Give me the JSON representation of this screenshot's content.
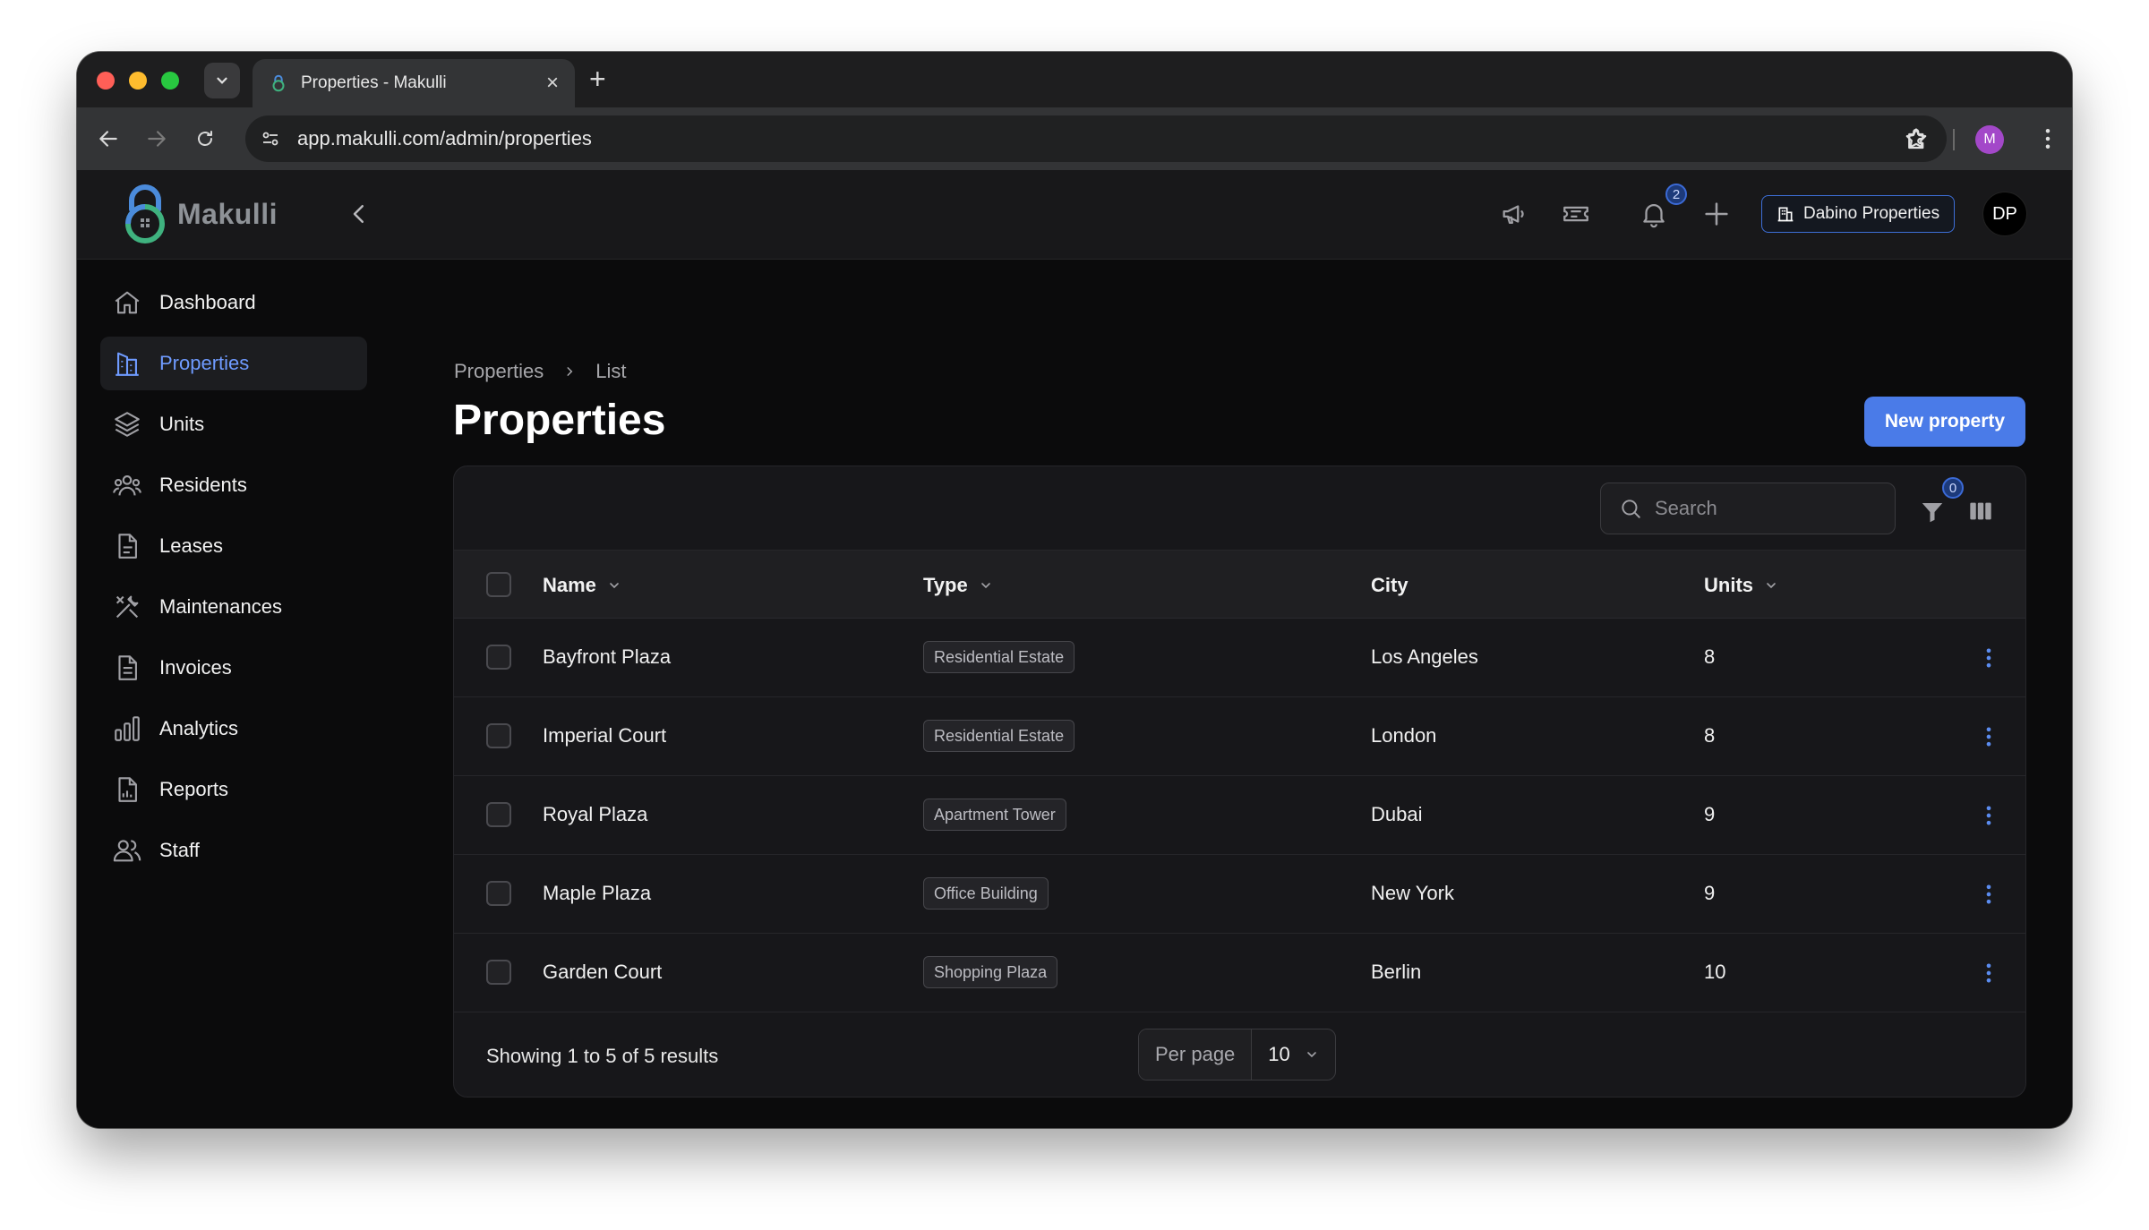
{
  "browser": {
    "tab_title": "Properties - Makulli",
    "url": "app.makulli.com/admin/properties",
    "profile_initial": "M"
  },
  "app": {
    "logo_text": "Makulli",
    "notification_count": "2",
    "tenant_name": "Dabino Properties",
    "user_initials": "DP",
    "accent_color": "#4a7be8"
  },
  "sidebar": {
    "items": [
      {
        "label": "Dashboard",
        "icon": "home-icon"
      },
      {
        "label": "Properties",
        "icon": "building-icon",
        "active": true
      },
      {
        "label": "Units",
        "icon": "layers-icon"
      },
      {
        "label": "Residents",
        "icon": "users-icon"
      },
      {
        "label": "Leases",
        "icon": "document-icon"
      },
      {
        "label": "Maintenances",
        "icon": "tools-icon"
      },
      {
        "label": "Invoices",
        "icon": "invoice-icon"
      },
      {
        "label": "Analytics",
        "icon": "bar-chart-icon"
      },
      {
        "label": "Reports",
        "icon": "report-icon"
      },
      {
        "label": "Staff",
        "icon": "staff-icon"
      }
    ]
  },
  "page": {
    "breadcrumb": [
      "Properties",
      "List"
    ],
    "title": "Properties",
    "new_button": "New property"
  },
  "table": {
    "search_placeholder": "Search",
    "filter_count": "0",
    "columns": [
      "Name",
      "Type",
      "City",
      "Units"
    ],
    "rows": [
      {
        "name": "Bayfront Plaza",
        "type": "Residential Estate",
        "city": "Los Angeles",
        "units": "8"
      },
      {
        "name": "Imperial Court",
        "type": "Residential Estate",
        "city": "London",
        "units": "8"
      },
      {
        "name": "Royal Plaza",
        "type": "Apartment Tower",
        "city": "Dubai",
        "units": "9"
      },
      {
        "name": "Maple Plaza",
        "type": "Office Building",
        "city": "New York",
        "units": "9"
      },
      {
        "name": "Garden Court",
        "type": "Shopping Plaza",
        "city": "Berlin",
        "units": "10"
      }
    ],
    "results_text": "Showing 1 to 5 of 5 results",
    "per_page_label": "Per page",
    "per_page_value": "10"
  }
}
